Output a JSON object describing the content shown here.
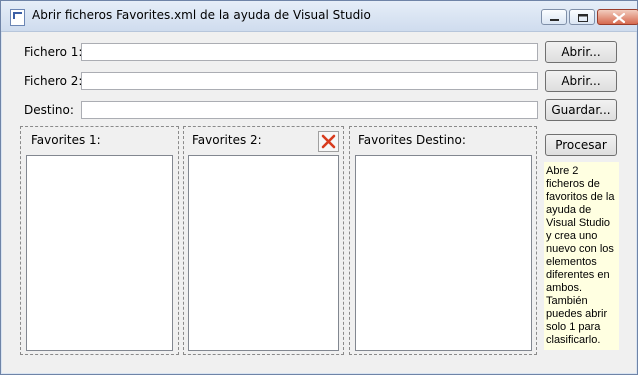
{
  "window": {
    "title": "Abrir ficheros Favorites.xml de la ayuda de Visual Studio",
    "controls": [
      "minimize-icon",
      "maximize-icon",
      "close-icon"
    ]
  },
  "form": {
    "fichero1_label": "Fichero 1:",
    "fichero1_value": "",
    "fichero2_label": "Fichero 2:",
    "fichero2_value": "",
    "destino_label": "Destino:",
    "destino_value": "",
    "abrir1_button": "Abrir...",
    "abrir2_button": "Abrir...",
    "guardar_button": "Guardar..."
  },
  "panels": {
    "favorites1_label": "Favorites 1:",
    "favorites2_label": "Favorites 2:",
    "destino_label": "Favorites Destino:",
    "clear_icon": "clear-icon",
    "clear_color": "#d83b1d"
  },
  "side": {
    "procesar_button": "Procesar",
    "info_text": "Abre 2 ficheros de favoritos de la ayuda de Visual Studio y crea uno nuevo con los elementos diferentes en ambos. También puedes abrir solo 1 para clasificarlo."
  }
}
